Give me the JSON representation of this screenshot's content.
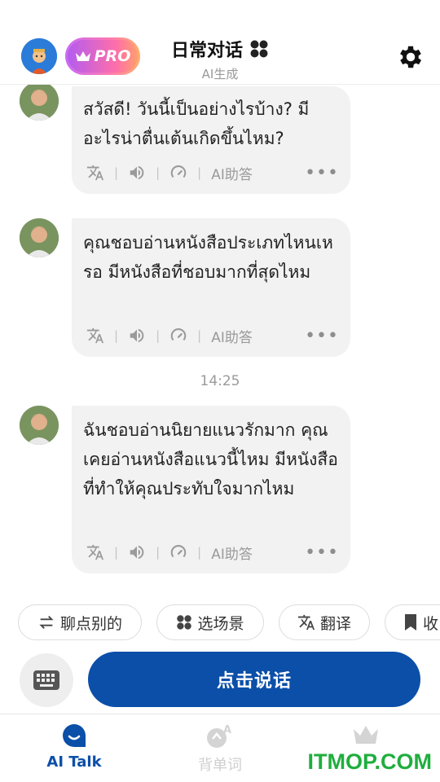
{
  "header": {
    "pro_label": "PRO",
    "title": "日常对话",
    "subtitle": "AI生成"
  },
  "messages": [
    {
      "text": "สวัสดี! วันนี้เป็นอย่างไรบ้าง? มีอะไรน่าตื่นเต้นเกิดขึ้นไหม?"
    },
    {
      "text": "คุณชอบอ่านหนังสือประเภทไหนเหรอ มีหนังสือที่ชอบมากที่สุดไหม"
    },
    {
      "text": "ฉันชอบอ่านนิยายแนวรักมาก คุณเคยอ่านหนังสือแนวนี้ไหม มีหนังสือที่ทำให้คุณประทับใจมากไหม"
    }
  ],
  "message_tools": {
    "ai_help": "AI助答",
    "more": "•••"
  },
  "timestamp": "14:25",
  "chips": {
    "topic": "聊点别的",
    "scene": "选场景",
    "translate": "翻译",
    "fourth": "收"
  },
  "input": {
    "talk_label": "点击说话"
  },
  "nav": {
    "ai_talk": "AI Talk",
    "vocab": "背单词",
    "vip": ""
  },
  "watermark": "ITMOP.COM",
  "colors": {
    "accent": "#0b4fa8",
    "bubble": "#f2f2f2",
    "watermark": "#1fae3e"
  }
}
